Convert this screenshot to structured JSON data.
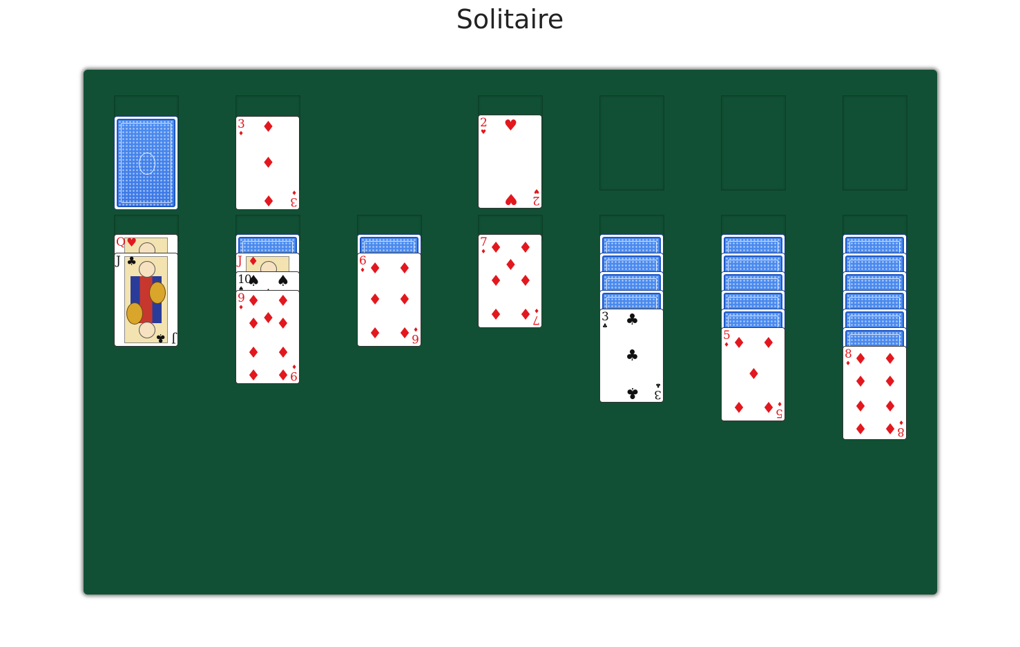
{
  "title": "Solitaire",
  "colors": {
    "felt": "#115034",
    "red_suit": "#e2181e",
    "black_suit": "#111111",
    "card_back": "#3b78e6"
  },
  "stock": {
    "card": "face-down"
  },
  "waste": {
    "card": {
      "rank": "3",
      "suit": "diamonds"
    }
  },
  "foundations": [
    {
      "card": {
        "rank": "2",
        "suit": "hearts"
      }
    },
    {
      "card": null
    },
    {
      "card": null
    },
    {
      "card": null
    }
  ],
  "tableau": [
    {
      "face_down": 0,
      "face_up": [
        {
          "rank": "Q",
          "suit": "hearts"
        },
        {
          "rank": "J",
          "suit": "clubs"
        }
      ]
    },
    {
      "face_down": 1,
      "face_up": [
        {
          "rank": "J",
          "suit": "diamonds"
        },
        {
          "rank": "10",
          "suit": "spades"
        },
        {
          "rank": "9",
          "suit": "diamonds"
        }
      ]
    },
    {
      "face_down": 1,
      "face_up": [
        {
          "rank": "6",
          "suit": "diamonds"
        }
      ]
    },
    {
      "face_down": 0,
      "face_up": [
        {
          "rank": "7",
          "suit": "diamonds"
        }
      ]
    },
    {
      "face_down": 4,
      "face_up": [
        {
          "rank": "3",
          "suit": "clubs"
        }
      ]
    },
    {
      "face_down": 5,
      "face_up": [
        {
          "rank": "5",
          "suit": "diamonds"
        }
      ]
    },
    {
      "face_down": 6,
      "face_up": [
        {
          "rank": "8",
          "suit": "diamonds"
        }
      ]
    }
  ]
}
